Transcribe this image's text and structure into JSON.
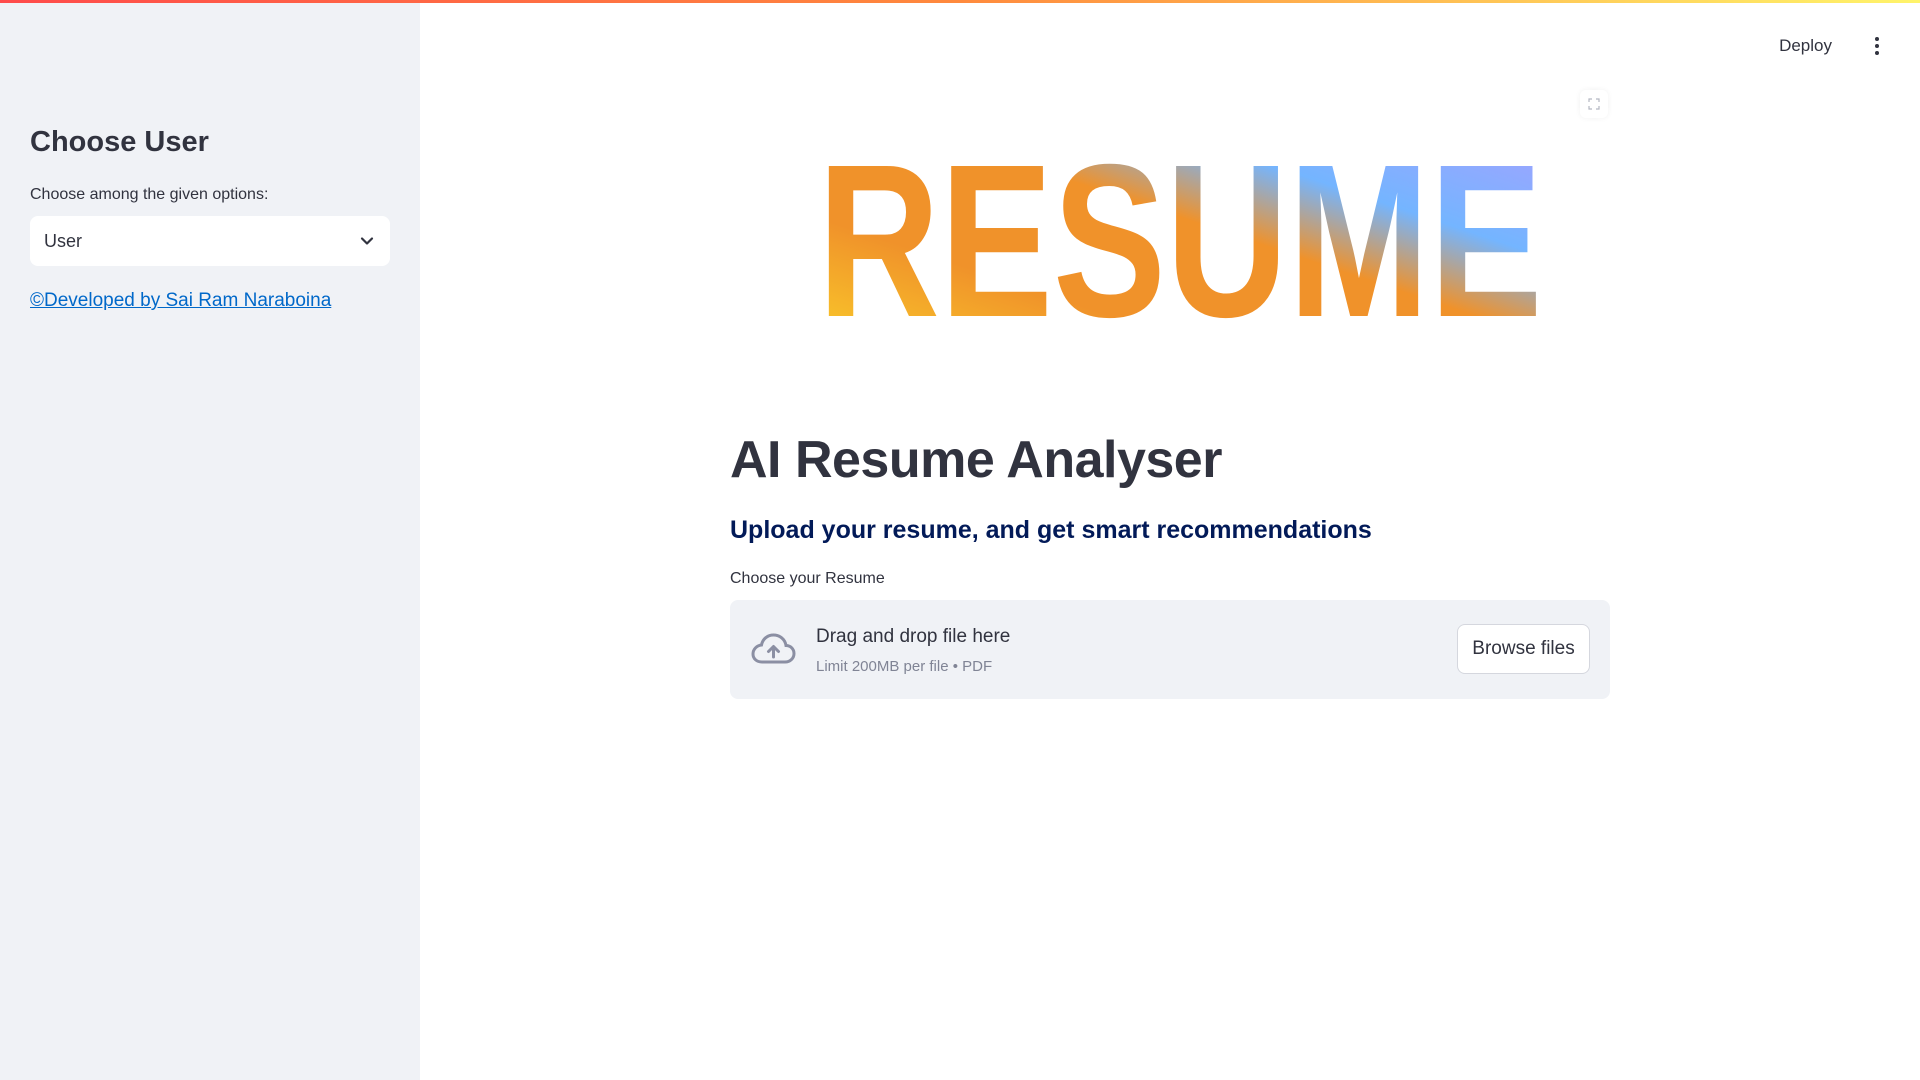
{
  "header": {
    "deploy_label": "Deploy",
    "menu_icon": "kebab-menu-icon",
    "stripe_colors": [
      "#ff4b4b",
      "#ff8a3d",
      "#fff46a"
    ]
  },
  "sidebar": {
    "heading": "Choose User",
    "select_label": "Choose among the given options:",
    "selected_value": "User",
    "dropdown_icon": "chevron-down-icon",
    "footer_link": "©Developed by Sai Ram Naraboina"
  },
  "main": {
    "hero_image": {
      "text": "RESUME",
      "icon": "fullscreen-icon",
      "gradient_colors": [
        "#fbd32a",
        "#f0922a",
        "#74b5ff",
        "#a8a0ff"
      ]
    },
    "title": "AI Resume Analyser",
    "subtitle": "Upload your resume, and get smart recommendations",
    "uploader": {
      "label": "Choose your Resume",
      "drop_text": "Drag and drop file here",
      "limit_text": "Limit 200MB per file • PDF",
      "button_label": "Browse files",
      "icon": "cloud-upload-icon"
    }
  },
  "colors": {
    "sidebar_bg": "#f0f2f6",
    "link": "#0068c9",
    "subtitle": "#021a58",
    "text": "#31333f"
  }
}
